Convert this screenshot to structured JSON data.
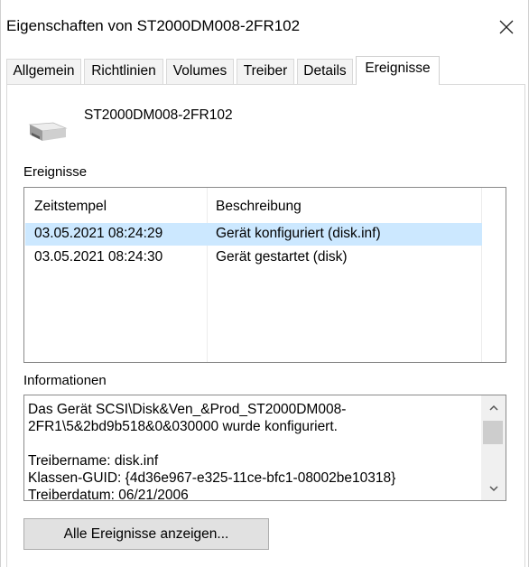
{
  "window": {
    "title": "Eigenschaften von ST2000DM008-2FR102",
    "close_icon": "close-icon"
  },
  "tabs": [
    {
      "label": "Allgemein",
      "active": false
    },
    {
      "label": "Richtlinien",
      "active": false
    },
    {
      "label": "Volumes",
      "active": false
    },
    {
      "label": "Treiber",
      "active": false
    },
    {
      "label": "Details",
      "active": false
    },
    {
      "label": "Ereignisse",
      "active": true
    }
  ],
  "device": {
    "icon": "hard-disk-icon",
    "name": "ST2000DM008-2FR102"
  },
  "events": {
    "section_label": "Ereignisse",
    "columns": [
      "Zeitstempel",
      "Beschreibung"
    ],
    "rows": [
      {
        "timestamp": "03.05.2021 08:24:29",
        "description": "Gerät konfiguriert (disk.inf)",
        "selected": true
      },
      {
        "timestamp": "03.05.2021 08:24:30",
        "description": "Gerät gestartet (disk)",
        "selected": false
      }
    ],
    "selection_color": "#cce8ff"
  },
  "information": {
    "section_label": "Informationen",
    "lines": [
      "Das Gerät SCSI\\Disk&Ven_&Prod_ST2000DM008-",
      "2FR1\\5&2bd9b518&0&030000 wurde konfiguriert.",
      "",
      "Treibername: disk.inf",
      "Klassen-GUID: {4d36e967-e325-11ce-bfc1-08002be10318}",
      "Treiberdatum: 06/21/2006"
    ]
  },
  "buttons": {
    "show_all_events": "Alle Ereignisse anzeigen..."
  }
}
